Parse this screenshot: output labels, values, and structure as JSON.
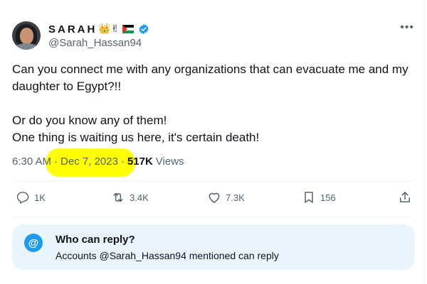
{
  "user": {
    "display_name": "SARAH",
    "emojis": "👑✌",
    "handle": "@Sarah_Hassan94",
    "verified": true
  },
  "more_label": "•••",
  "post": {
    "line1": "Can you connect me with any organizations that can evacuate me and my daughter to Egypt?!!",
    "line2": "Or do you know any of them!",
    "line3": "One thing is waiting us here, it's certain death!"
  },
  "meta": {
    "time": "6:30 AM",
    "sep1": "·",
    "date": "Dec 7, 2023",
    "sep2": "·",
    "views_count": "517K",
    "views_label": "Views"
  },
  "actions": {
    "replies": "1K",
    "reposts": "3.4K",
    "likes": "7.3K",
    "bookmarks": "156"
  },
  "reply_settings": {
    "title": "Who can reply?",
    "subtitle": "Accounts @Sarah_Hassan94 mentioned can reply",
    "icon": "@"
  },
  "colors": {
    "accent": "#1d9bf0",
    "highlight": "#ffff00",
    "muted": "#536471"
  }
}
